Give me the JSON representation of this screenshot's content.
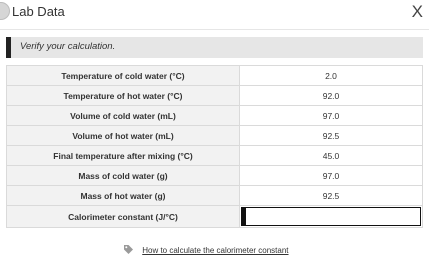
{
  "window": {
    "title": "Lab Data",
    "close_label": "X"
  },
  "banner": {
    "text": "Verify your calculation."
  },
  "table": {
    "rows": [
      {
        "label": "Temperature of cold water (°C)",
        "value": "2.0"
      },
      {
        "label": "Temperature of hot water (°C)",
        "value": "92.0"
      },
      {
        "label": "Volume of cold water (mL)",
        "value": "97.0"
      },
      {
        "label": "Volume of hot water (mL)",
        "value": "92.5"
      },
      {
        "label": "Final temperature after mixing (°C)",
        "value": "45.0"
      },
      {
        "label": "Mass of cold water (g)",
        "value": "97.0"
      },
      {
        "label": "Mass of hot water (g)",
        "value": "92.5"
      }
    ],
    "input_row": {
      "label": "Calorimeter constant (J/°C)",
      "value": ""
    }
  },
  "help": {
    "icon": "tag-icon",
    "link_text": "How to calculate the calorimeter constant"
  },
  "colors": {
    "label_bg": "#f2f2f2",
    "banner_bg": "#e6e6e6",
    "accent_bar": "#222222"
  }
}
